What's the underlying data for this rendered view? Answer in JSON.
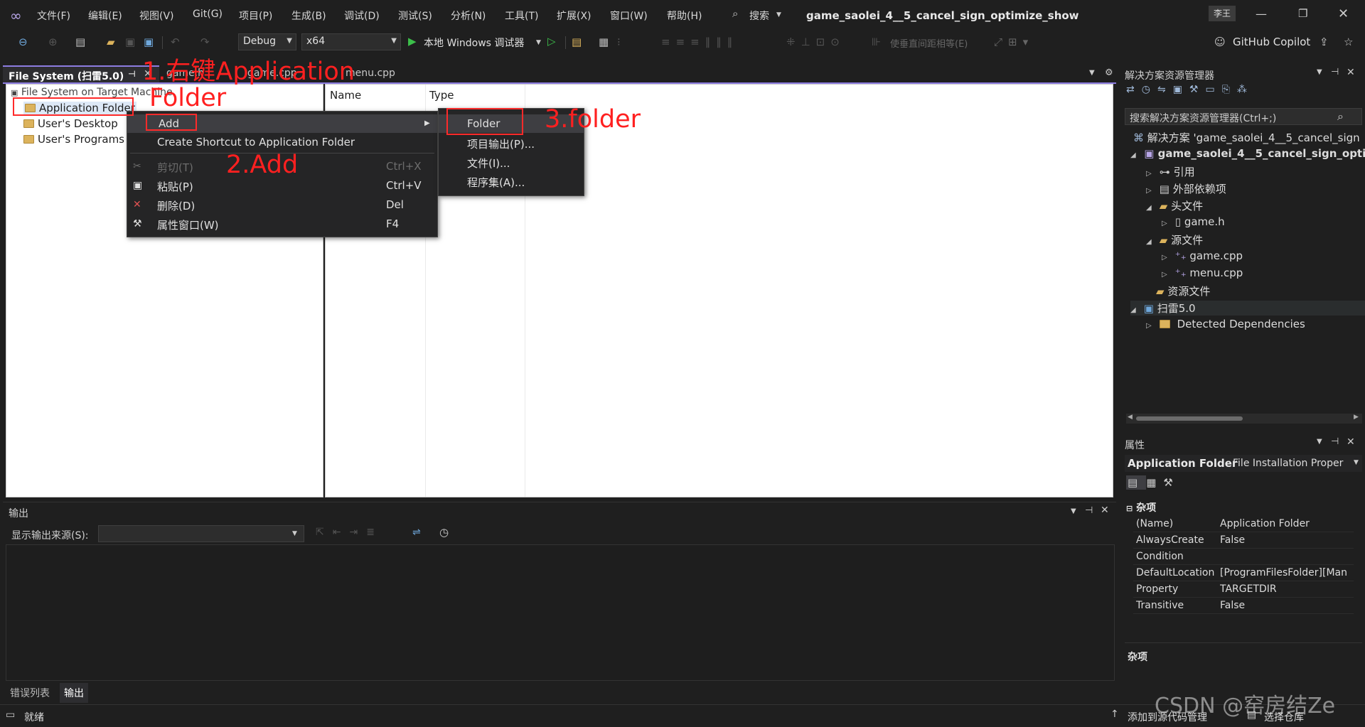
{
  "menubar": {
    "items": [
      "文件(F)",
      "编辑(E)",
      "视图(V)",
      "Git(G)",
      "项目(P)",
      "生成(B)",
      "调试(D)",
      "测试(S)",
      "分析(N)",
      "工具(T)",
      "扩展(X)",
      "窗口(W)",
      "帮助(H)"
    ],
    "search": "搜索",
    "window_title": "game_saolei_4__5_cancel_sign_optimize_show",
    "user_badge": "李王"
  },
  "toolbar": {
    "config": "Debug",
    "platform": "x64",
    "run_label": "本地 Windows 调试器",
    "spacing_label": "使垂直间距相等(E)",
    "copilot": "GitHub Copilot"
  },
  "doctabs": {
    "active": "File System (扫雷5.0)",
    "tab2": "game.h",
    "tab3": "game.cpp",
    "tab4": "menu.cpp"
  },
  "filesystem": {
    "root": "File System on Target Machine",
    "items": [
      "Application Folder",
      "User's Desktop",
      "User's Programs Menu"
    ],
    "col_name": "Name",
    "col_type": "Type"
  },
  "context_menu": {
    "add": "Add",
    "create_shortcut": "Create Shortcut to Application Folder",
    "cut": "剪切(T)",
    "cut_sc": "Ctrl+X",
    "paste": "粘贴(P)",
    "paste_sc": "Ctrl+V",
    "delete": "删除(D)",
    "delete_sc": "Del",
    "properties": "属性窗口(W)",
    "properties_sc": "F4"
  },
  "submenu": {
    "folder": "Folder",
    "project_output": "项目输出(P)...",
    "file": "文件(I)...",
    "assembly": "程序集(A)..."
  },
  "annotations": {
    "step1": "1.右键Application",
    "step1b": "Folder",
    "step2": "2.Add",
    "step3": "3.folder"
  },
  "solution_explorer": {
    "title": "解决方案资源管理器",
    "search": "搜索解决方案资源管理器(Ctrl+;)",
    "solution": "解决方案 'game_saolei_4__5_cancel_sign",
    "project": "game_saolei_4__5_cancel_sign_optir",
    "references": "引用",
    "external": "外部依赖项",
    "headers": "头文件",
    "game_h": "game.h",
    "sources": "源文件",
    "game_cpp": "game.cpp",
    "menu_cpp": "menu.cpp",
    "resources": "资源文件",
    "setup": "扫雷5.0",
    "detected": "Detected Dependencies"
  },
  "properties": {
    "title": "属性",
    "object": "Application Folder",
    "object_type": "File Installation Proper",
    "category": "杂项",
    "rows": [
      {
        "name": "(Name)",
        "value": "Application Folder"
      },
      {
        "name": "AlwaysCreate",
        "value": "False"
      },
      {
        "name": "Condition",
        "value": ""
      },
      {
        "name": "DefaultLocation",
        "value": "[ProgramFilesFolder][Man"
      },
      {
        "name": "Property",
        "value": "TARGETDIR"
      },
      {
        "name": "Transitive",
        "value": "False"
      }
    ],
    "desc_title": "杂项"
  },
  "output": {
    "title": "输出",
    "source_label": "显示输出来源(S):",
    "source_value": ""
  },
  "bottom_tabs": {
    "errors": "错误列表",
    "output": "输出"
  },
  "status": {
    "ready": "就绪",
    "source_control": "添加到源代码管理",
    "repo": "选择仓库"
  },
  "watermark": "CSDN @窑房结Ze"
}
